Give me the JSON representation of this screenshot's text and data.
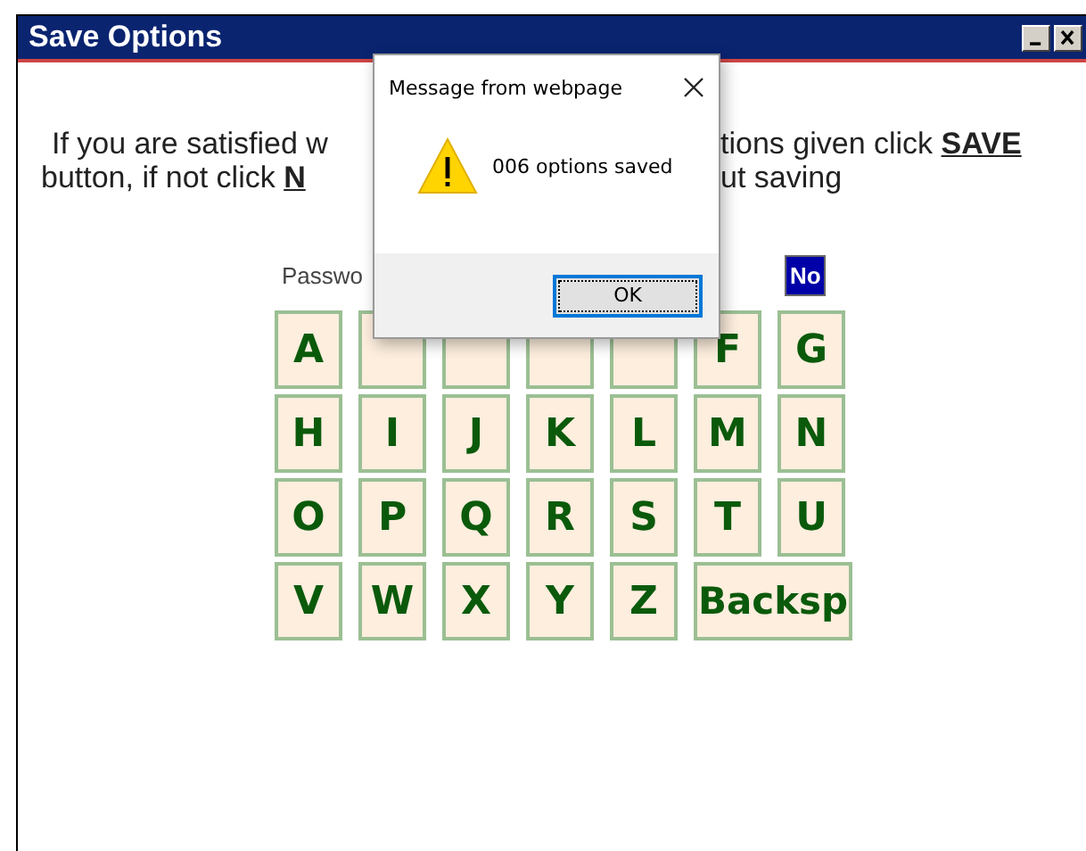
{
  "window": {
    "title": "Save Options"
  },
  "instructions": [
    {
      "before": "If you are satisfied w",
      "after": "tions given click **SAVE**"
    },
    {
      "before": "button, if not click **N**",
      "after": "ut saving"
    }
  ],
  "password_label": "Passwo",
  "no_button": "No",
  "keys": [
    [
      {
        "label": "A",
        "kind": "letter"
      },
      {
        "kind": "letter"
      },
      {
        "kind": "letter"
      },
      {
        "kind": "letter"
      },
      {
        "kind": "letter"
      },
      {
        "label": "F",
        "kind": "letter"
      },
      {
        "label": "G",
        "kind": "letter"
      }
    ],
    [
      {
        "label": "H",
        "kind": "letter"
      },
      {
        "label": "I",
        "kind": "letter"
      },
      {
        "label": "J",
        "kind": "letter"
      },
      {
        "label": "K",
        "kind": "letter"
      },
      {
        "label": "L",
        "kind": "letter"
      },
      {
        "label": "M",
        "kind": "letter"
      },
      {
        "label": "N",
        "kind": "letter"
      }
    ],
    [
      {
        "label": "O",
        "kind": "letter"
      },
      {
        "label": "P",
        "kind": "letter"
      },
      {
        "label": "Q",
        "kind": "letter"
      },
      {
        "label": "R",
        "kind": "letter"
      },
      {
        "label": "S",
        "kind": "letter"
      },
      {
        "label": "T",
        "kind": "letter"
      },
      {
        "label": "U",
        "kind": "letter"
      }
    ],
    [
      {
        "label": "V",
        "kind": "letter"
      },
      {
        "label": "W",
        "kind": "letter"
      },
      {
        "label": "X",
        "kind": "letter"
      },
      {
        "label": "Y",
        "kind": "letter"
      },
      {
        "label": "Z",
        "kind": "letter"
      },
      {
        "label": "Backsp",
        "kind": "wide"
      }
    ]
  ],
  "dialog": {
    "title": "Message from webpage",
    "message": "006 options saved",
    "button": {
      "label": "OK",
      "focused": true
    }
  }
}
